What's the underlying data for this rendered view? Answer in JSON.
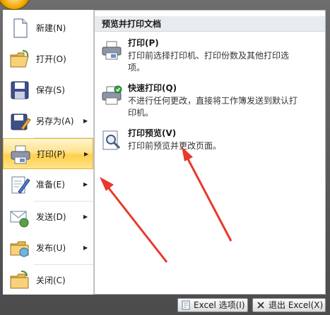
{
  "left_menu": {
    "items": [
      {
        "id": "new",
        "label": "新建(N)",
        "icon": "new-document-icon",
        "has_arrow": false
      },
      {
        "id": "open",
        "label": "打开(O)",
        "icon": "open-folder-icon",
        "has_arrow": false
      },
      {
        "id": "save",
        "label": "保存(S)",
        "icon": "floppy-disk-icon",
        "has_arrow": false
      },
      {
        "id": "save-as",
        "label": "另存为(A)",
        "icon": "save-as-icon",
        "has_arrow": true
      },
      {
        "id": "print",
        "label": "打印(P)",
        "icon": "printer-icon",
        "has_arrow": true,
        "active": true
      },
      {
        "id": "prepare",
        "label": "准备(E)",
        "icon": "prepare-pen-icon",
        "has_arrow": true
      },
      {
        "id": "send",
        "label": "发送(D)",
        "icon": "send-icon",
        "has_arrow": true
      },
      {
        "id": "publish",
        "label": "发布(U)",
        "icon": "publish-icon",
        "has_arrow": true
      },
      {
        "id": "close",
        "label": "关闭(C)",
        "icon": "close-folder-icon",
        "has_arrow": false
      }
    ],
    "arrow_glyph": "▶"
  },
  "submenu": {
    "header": "预览并打印文档",
    "items": [
      {
        "title": "打印(P)",
        "desc": "打印前选择打印机、打印份数及其他打印选项。",
        "icon": "printer-icon"
      },
      {
        "title": "快速打印(Q)",
        "desc": "不进行任何更改，直接将工作簿发送到默认打印机。",
        "icon": "quick-print-icon"
      },
      {
        "title": "打印预览(V)",
        "desc": "打印前预览并更改页面。",
        "icon": "print-preview-icon"
      }
    ]
  },
  "bottom_bar": {
    "options_label": "Excel 选项(I)",
    "exit_label": "退出 Excel(X)"
  },
  "colors": {
    "active_highlight": "#ffd04c",
    "annotation_arrow": "#e8392b"
  }
}
